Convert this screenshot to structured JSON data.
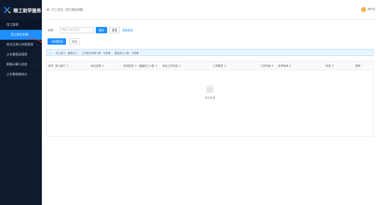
{
  "brand": {
    "name": "眼工助学服务"
  },
  "sidebar": {
    "items": [
      {
        "label": "用工管理",
        "chev": "⌄"
      },
      {
        "label": "用工岗位申报"
      },
      {
        "label": "岗位日常与申报管理",
        "chev": "⌄"
      },
      {
        "label": "工作量报送管理"
      },
      {
        "label": "薪酬计算与发放",
        "chev": "⌄"
      },
      {
        "label": "工作量数据统计",
        "chev": "⌄"
      }
    ]
  },
  "topbar": {
    "menu_icon": "≡",
    "crumb_1": "用工管理",
    "crumb_sep": "/",
    "crumb_2": "用工岗位申报",
    "user": "用户名"
  },
  "search": {
    "label": "名称：",
    "placeholder": "请输入岗位名称",
    "dropdown": "⌄",
    "query_btn": "查询",
    "reset_btn": "重置",
    "advanced_link": "高级查询"
  },
  "actions": {
    "apply_btn": "+新增岗位",
    "export_btn": "导出"
  },
  "info": {
    "icon": "ⓘ",
    "t1": "用工部门：建德中心",
    "t2": "工作岗位申报人数：可查看",
    "t3": "最高用工人数：可查看"
  },
  "table": {
    "headers": [
      "序号",
      "用工部门 ↕",
      "岗位名称 ↕",
      "岗位性质 ↕",
      "最高用工人数 ↕",
      "岗位工作内容 ↕",
      "工作要求 ↕",
      "工作时间 ↕",
      "负责老师 ↕",
      "状态 ↕",
      "操作"
    ],
    "empty": "暂无数据"
  },
  "colors": {
    "sidebar": "#0f1a2e",
    "accent": "#1d8fff"
  }
}
